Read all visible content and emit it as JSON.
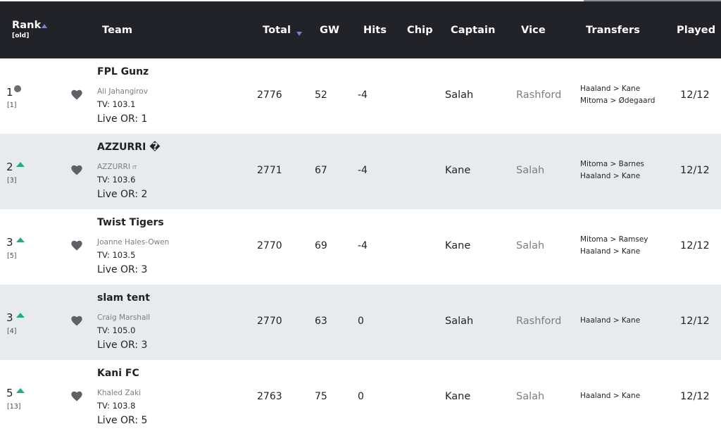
{
  "colors": {
    "header_bg": "#212328",
    "sort_indicator": "#7b7be0",
    "rank_up": "#1eb27a",
    "rank_same": "#6b6d72",
    "alt_row_bg": "#e8ebee"
  },
  "header": {
    "rank": "Rank",
    "rank_sub": "[old]",
    "rank_sort_icon": "sort-ascending-icon",
    "team": "Team",
    "total": "Total",
    "total_sort_icon": "sort-descending-icon",
    "gw": "GW",
    "hits": "Hits",
    "chip": "Chip",
    "captain": "Captain",
    "vice": "Vice",
    "transfers": "Transfers",
    "played": "Played"
  },
  "rows": [
    {
      "rank": "1",
      "rank_change": "same",
      "old_rank": "[1]",
      "team": "FPL Gunz",
      "manager": "Ali Jahangirov",
      "flag": "",
      "tv": "TV: 103.1",
      "live_or": "Live OR: 1",
      "total": "2776",
      "gw": "52",
      "hits": "-4",
      "chip": "",
      "captain": "Salah",
      "vice": "Rashford",
      "transfers": [
        "Haaland > Kane",
        "Mitoma > Ødegaard"
      ],
      "played": "12/12"
    },
    {
      "rank": "2",
      "rank_change": "up",
      "old_rank": "[3]",
      "team": "AZZURRI �",
      "manager": "AZZURRI",
      "flag": "IT",
      "tv": "TV: 103.6",
      "live_or": "Live OR: 2",
      "total": "2771",
      "gw": "67",
      "hits": "-4",
      "chip": "",
      "captain": "Kane",
      "vice": "Salah",
      "transfers": [
        "Mitoma > Barnes",
        "Haaland > Kane"
      ],
      "played": "12/12"
    },
    {
      "rank": "3",
      "rank_change": "up",
      "old_rank": "[5]",
      "team": "Twist Tigers",
      "manager": "Joanne Hales-Owen",
      "flag": "",
      "tv": "TV: 103.5",
      "live_or": "Live OR: 3",
      "total": "2770",
      "gw": "69",
      "hits": "-4",
      "chip": "",
      "captain": "Kane",
      "vice": "Salah",
      "transfers": [
        "Mitoma > Ramsey",
        "Haaland > Kane"
      ],
      "played": "12/12"
    },
    {
      "rank": "3",
      "rank_change": "up",
      "old_rank": "[4]",
      "team": "slam tent",
      "manager": "Craig Marshall",
      "flag": "",
      "tv": "TV: 105.0",
      "live_or": "Live OR: 3",
      "total": "2770",
      "gw": "63",
      "hits": "0",
      "chip": "",
      "captain": "Salah",
      "vice": "Rashford",
      "transfers": [
        "Haaland > Kane"
      ],
      "played": "12/12"
    },
    {
      "rank": "5",
      "rank_change": "up",
      "old_rank": "[13]",
      "team": "Kani FC",
      "manager": "Khaled Zaki",
      "flag": "",
      "tv": "TV: 103.8",
      "live_or": "Live OR: 5",
      "total": "2763",
      "gw": "75",
      "hits": "0",
      "chip": "",
      "captain": "Kane",
      "vice": "Salah",
      "transfers": [
        "Haaland > Kane"
      ],
      "played": "12/12"
    }
  ]
}
